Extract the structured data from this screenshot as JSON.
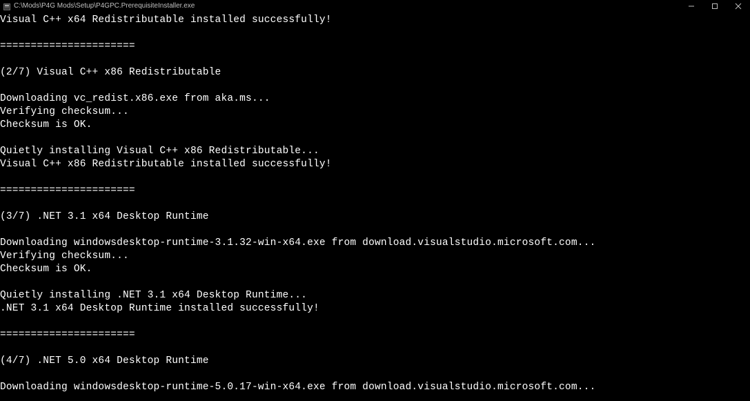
{
  "titlebar": {
    "title": "C:\\Mods\\P4G Mods\\Setup\\P4GPC.PrerequisiteInstaller.exe"
  },
  "console": {
    "lines": [
      "Visual C++ x64 Redistributable installed successfully!",
      "",
      "======================",
      "",
      "(2/7) Visual C++ x86 Redistributable",
      "",
      "Downloading vc_redist.x86.exe from aka.ms...",
      "Verifying checksum...",
      "Checksum is OK.",
      "",
      "Quietly installing Visual C++ x86 Redistributable...",
      "Visual C++ x86 Redistributable installed successfully!",
      "",
      "======================",
      "",
      "(3/7) .NET 3.1 x64 Desktop Runtime",
      "",
      "Downloading windowsdesktop-runtime-3.1.32-win-x64.exe from download.visualstudio.microsoft.com...",
      "Verifying checksum...",
      "Checksum is OK.",
      "",
      "Quietly installing .NET 3.1 x64 Desktop Runtime...",
      ".NET 3.1 x64 Desktop Runtime installed successfully!",
      "",
      "======================",
      "",
      "(4/7) .NET 5.0 x64 Desktop Runtime",
      "",
      "Downloading windowsdesktop-runtime-5.0.17-win-x64.exe from download.visualstudio.microsoft.com..."
    ]
  }
}
